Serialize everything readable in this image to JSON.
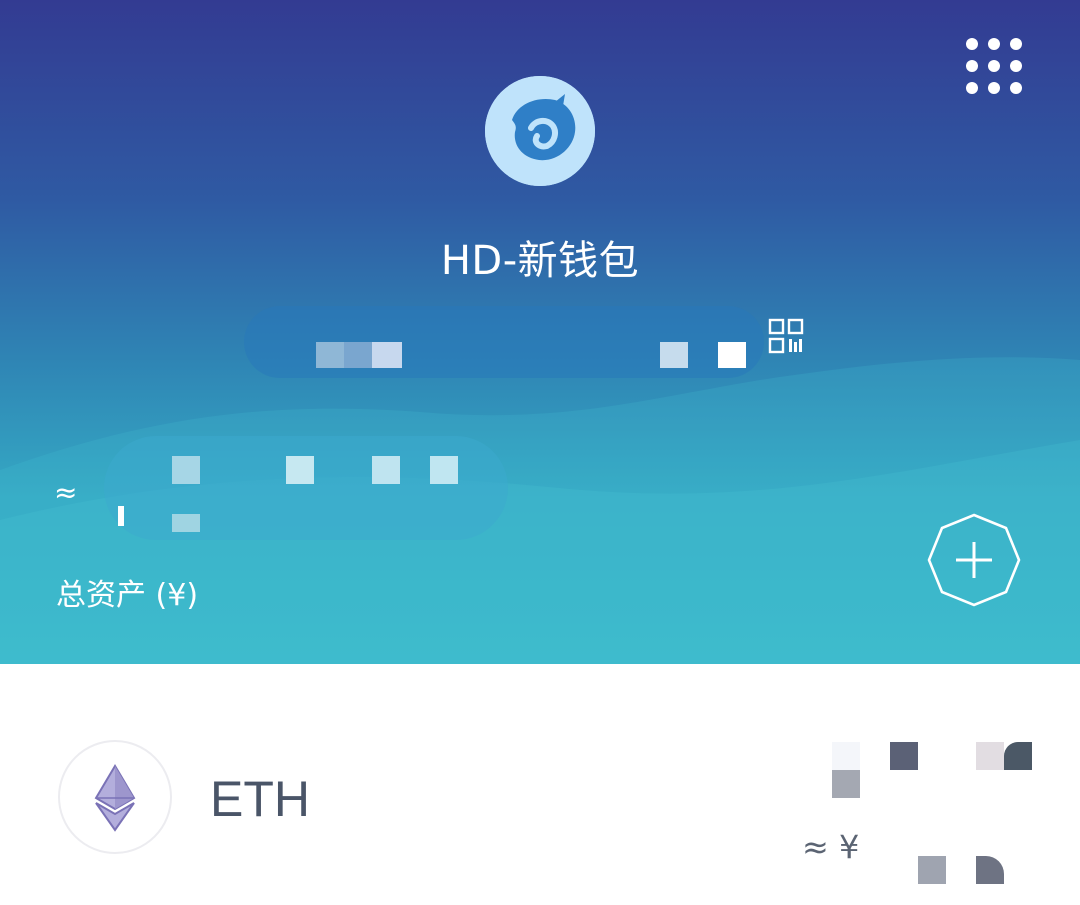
{
  "header": {
    "wallet_name": "HD-新钱包",
    "total_assets_label": "总资产 (¥)",
    "approx_sign": "≈",
    "colors": {
      "top": "#333b92",
      "bottom": "#39b8c9",
      "avatar_bg": "#bfe3fb"
    }
  },
  "icons": {
    "menu": "grid-menu-icon",
    "avatar": "wallet-avatar-icon",
    "qr": "qr-code-icon",
    "add": "add-asset-icon",
    "eth": "ethereum-icon"
  },
  "assets": [
    {
      "symbol": "ETH",
      "fiat_prefix": "≈ ¥"
    }
  ]
}
